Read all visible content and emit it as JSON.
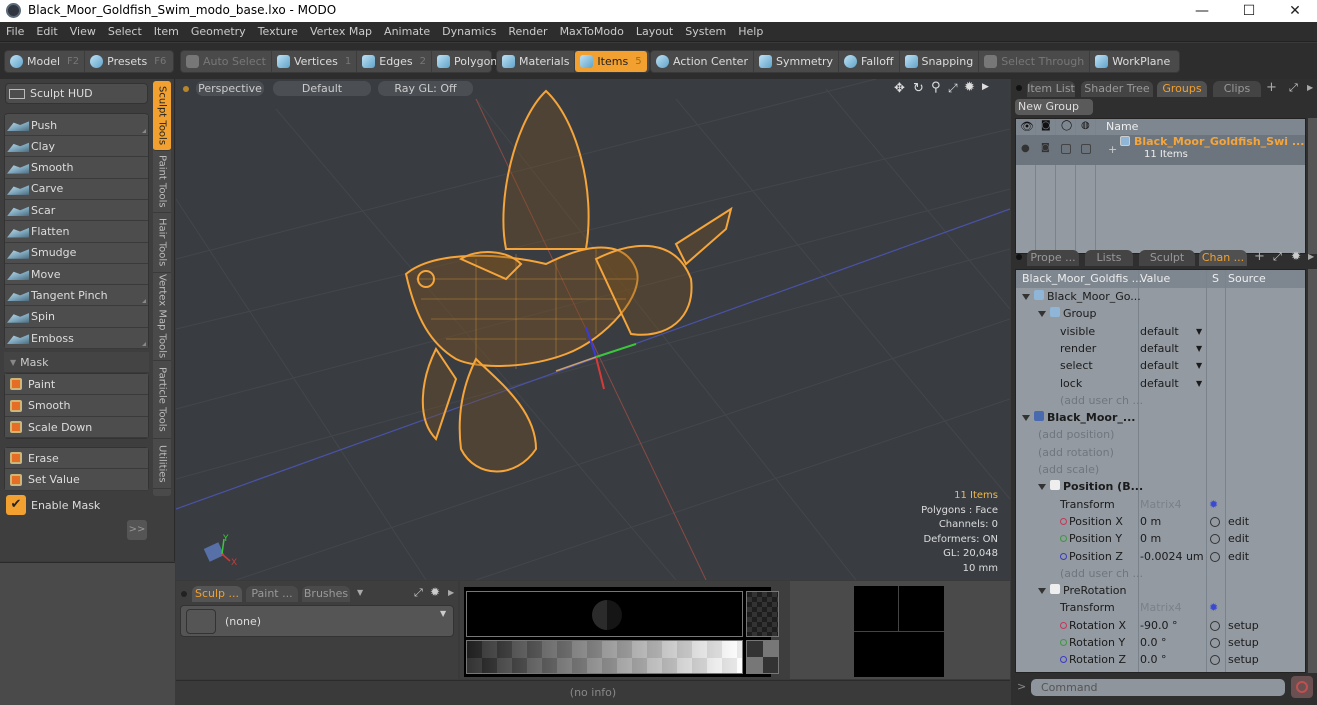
{
  "window": {
    "title": "Black_Moor_Goldfish_Swim_modo_base.lxo - MODO",
    "controls": {
      "minimize": "—",
      "maximize": "☐",
      "close": "✕"
    }
  },
  "menu": [
    "File",
    "Edit",
    "View",
    "Select",
    "Item",
    "Geometry",
    "Texture",
    "Vertex Map",
    "Animate",
    "Dynamics",
    "Render",
    "MaxToModo",
    "Layout",
    "System",
    "Help"
  ],
  "toolbar": {
    "mode": [
      {
        "label": "Model",
        "key": "F2",
        "icon": "model-sphere-icon"
      },
      {
        "label": "Presets",
        "key": "F6",
        "icon": "presets-icon"
      }
    ],
    "selection": [
      {
        "label": "Auto Select",
        "key": "",
        "icon": "auto-select-icon",
        "state": "disabled"
      },
      {
        "label": "Vertices",
        "key": "1",
        "icon": "vertices-icon"
      },
      {
        "label": "Edges",
        "key": "2",
        "icon": "edges-icon"
      },
      {
        "label": "Polygons",
        "key": "",
        "icon": "polygons-icon"
      }
    ],
    "items": [
      {
        "label": "Materials",
        "key": "",
        "icon": "materials-icon"
      },
      {
        "label": "Items",
        "key": "5",
        "icon": "items-icon",
        "state": "active"
      }
    ],
    "tools": [
      {
        "label": "Action Center",
        "icon": "action-center-icon"
      },
      {
        "label": "Symmetry",
        "icon": "symmetry-icon"
      },
      {
        "label": "Falloff",
        "icon": "falloff-icon"
      },
      {
        "label": "Snapping",
        "icon": "snapping-icon"
      },
      {
        "label": "Select Through",
        "icon": "select-through-icon",
        "state": "disabled"
      },
      {
        "label": "WorkPlane",
        "icon": "workplane-icon"
      }
    ]
  },
  "left_panel": {
    "hud_label": "Sculpt HUD",
    "sculpt_tools": [
      "Push",
      "Clay",
      "Smooth",
      "Carve",
      "Scar",
      "Flatten",
      "Smudge",
      "Move",
      "Tangent Pinch",
      "Spin",
      "Emboss"
    ],
    "mask_header": "Mask",
    "mask_tools": [
      "Paint",
      "Smooth",
      "Scale Down"
    ],
    "mask_tools_2": [
      "Erase",
      "Set Value"
    ],
    "enable_mask_label": "Enable Mask",
    "enable_mask_checked": true,
    "expand_label": ">>",
    "vertical_tabs": [
      {
        "label": "Sculpt Tools",
        "active": true
      },
      {
        "label": "Paint Tools"
      },
      {
        "label": "Hair Tools"
      },
      {
        "label": "Vertex Map Tools"
      },
      {
        "label": "Particle Tools"
      },
      {
        "label": "Utilities"
      }
    ]
  },
  "viewport": {
    "view_label": "Perspective",
    "shading_label": "Default",
    "raygl_label": "Ray GL: Off",
    "info": {
      "items": "11 Items",
      "polygons": "Polygons : Face",
      "channels": "Channels: 0",
      "deformers": "Deformers: ON",
      "gl": "GL: 20,048",
      "unit": "10 mm"
    },
    "axis_labels": {
      "x": "X",
      "y": "Y"
    },
    "accent_color": "#f5a53a"
  },
  "bottom_panel": {
    "tabs": [
      {
        "label": "Sculp ...",
        "active": true
      },
      {
        "label": "Paint ..."
      },
      {
        "label": "Brushes"
      }
    ],
    "preset_value": "(none)"
  },
  "status_bar": {
    "text": "(no info)"
  },
  "right_top": {
    "tabs": [
      {
        "label": "Item List"
      },
      {
        "label": "Shader Tree"
      },
      {
        "label": "Groups",
        "active": true
      },
      {
        "label": "Clips"
      }
    ],
    "new_group_label": "New Group",
    "name_header": "Name",
    "group": {
      "name": "Black_Moor_Goldfish_Swi ...",
      "count": "11 Items"
    }
  },
  "right_bottom": {
    "tabs": [
      {
        "label": "Prope ..."
      },
      {
        "label": "Lists"
      },
      {
        "label": "Sculpt"
      },
      {
        "label": "Chan ...",
        "active": true
      }
    ],
    "columns": {
      "name": "Black_Moor_Goldfis ...",
      "value": "Value",
      "s": "S",
      "source": "Source"
    },
    "rows": [
      {
        "name": "Black_Moor_Go...",
        "indent": 1,
        "type": "mesh",
        "expand": true
      },
      {
        "name": "Group",
        "indent": 2,
        "type": "group",
        "expand": true
      },
      {
        "name": "visible",
        "indent": 3,
        "value": "default",
        "dropdown": true
      },
      {
        "name": "render",
        "indent": 3,
        "value": "default",
        "dropdown": true
      },
      {
        "name": "select",
        "indent": 3,
        "value": "default",
        "dropdown": true
      },
      {
        "name": "lock",
        "indent": 3,
        "value": "default",
        "dropdown": true
      },
      {
        "name": "(add user ch ...",
        "indent": 3,
        "gray": true
      },
      {
        "name": "Black_Moor_...",
        "indent": 1,
        "bold": true,
        "type": "locator",
        "expand": true
      },
      {
        "name": "(add position)",
        "indent": 2,
        "gray": true
      },
      {
        "name": "(add rotation)",
        "indent": 2,
        "gray": true
      },
      {
        "name": "(add scale)",
        "indent": 2,
        "gray": true
      },
      {
        "name": "Position (B...",
        "indent": 2,
        "bold": true,
        "type": "transform",
        "expand": true
      },
      {
        "name": "Transform",
        "indent": 3,
        "value": "Matrix4",
        "valueGray": true,
        "gear": true
      },
      {
        "name": "Position X",
        "indent": 3,
        "dot": "#c0395a",
        "value": "0 m",
        "circle": true,
        "source": "edit"
      },
      {
        "name": "Position Y",
        "indent": 3,
        "dot": "#3a9a3a",
        "value": "0 m",
        "circle": true,
        "source": "edit"
      },
      {
        "name": "Position Z",
        "indent": 3,
        "dot": "#3a3ac0",
        "value": "-0.0024 um",
        "circle": true,
        "source": "edit"
      },
      {
        "name": "(add user ch ...",
        "indent": 3,
        "gray": true
      },
      {
        "name": "PreRotation",
        "indent": 2,
        "type": "rotation",
        "expand": true
      },
      {
        "name": "Transform",
        "indent": 3,
        "value": "Matrix4",
        "valueGray": true,
        "gear": true
      },
      {
        "name": "Rotation X",
        "indent": 3,
        "dot": "#c0395a",
        "value": "-90.0 °",
        "circle": true,
        "source": "setup"
      },
      {
        "name": "Rotation Y",
        "indent": 3,
        "dot": "#3a9a3a",
        "value": "0.0 °",
        "circle": true,
        "source": "setup"
      },
      {
        "name": "Rotation Z",
        "indent": 3,
        "dot": "#3a3ac0",
        "value": "0.0 °",
        "circle": true,
        "source": "setup"
      }
    ]
  },
  "command": {
    "placeholder": "Command",
    "prompt": ">"
  }
}
